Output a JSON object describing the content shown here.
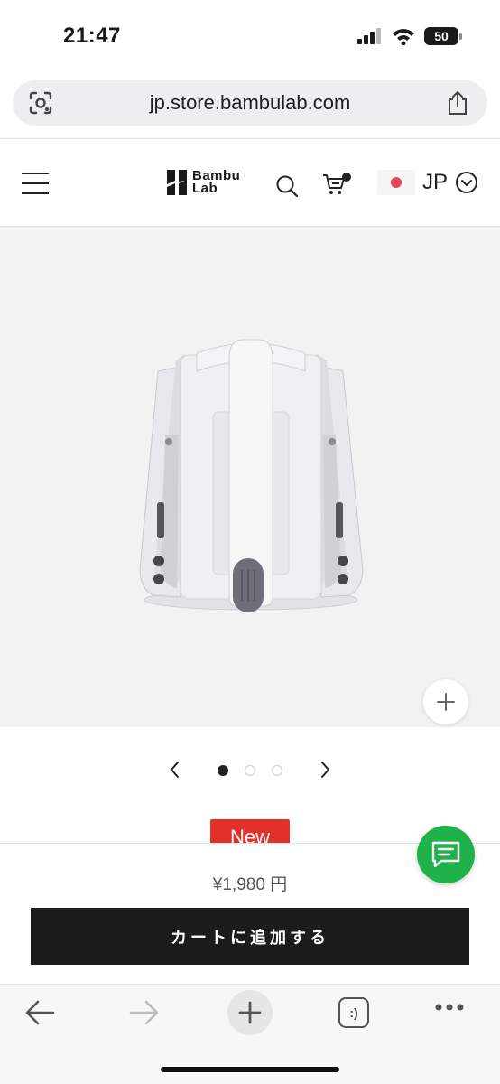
{
  "status_bar": {
    "time": "21:47",
    "battery": "50",
    "icons": [
      "signal-icon",
      "wifi-icon",
      "battery-icon"
    ]
  },
  "browser": {
    "url": "jp.store.bambulab.com",
    "icons": [
      "lens-icon",
      "share-icon"
    ]
  },
  "header": {
    "logo_line1": "Bambu",
    "logo_line2": "Lab",
    "region_code": "JP",
    "icons": [
      "menu-icon",
      "search-icon",
      "cart-icon",
      "chevron-down-icon"
    ]
  },
  "product": {
    "image_count": 3,
    "active_image": 1,
    "badge": "New",
    "price": "¥1,980 円"
  },
  "cta": {
    "add_to_cart_label": "カートに追加する"
  },
  "toolbar": {
    "tabs_label": ":)",
    "icons": [
      "back-arrow-icon",
      "forward-arrow-icon",
      "plus-icon",
      "tabs-icon",
      "more-icon"
    ]
  },
  "colors": {
    "badge": "#e4302b",
    "chat": "#1fb24a",
    "cta": "#1c1c1c",
    "flag_dot": "#e8455a"
  }
}
